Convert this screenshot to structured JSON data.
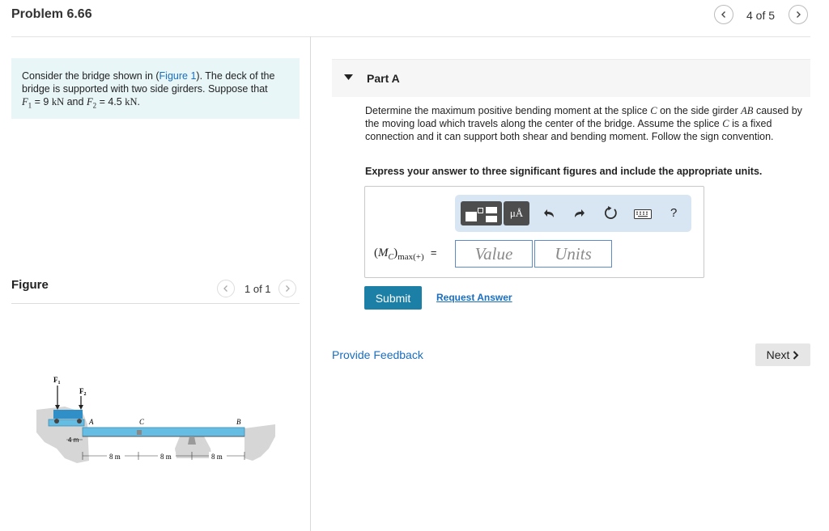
{
  "header": {
    "title": "Problem 6.66",
    "pager": "4 of 5"
  },
  "intro": {
    "text_before_link": "Consider the bridge shown in (",
    "figure_link": "Figure 1",
    "text_after_link": "). The deck of the bridge is supported with two side girders. Suppose that",
    "f1_symbol": "F",
    "f1_sub": "1",
    "f1_value": "= 9",
    "f1_unit": "kN",
    "and": "and",
    "f2_symbol": "F",
    "f2_sub": "2",
    "f2_value": "= 4.5",
    "f2_unit": "kN",
    "end": "."
  },
  "figure": {
    "heading": "Figure",
    "pager": "1 of 1",
    "labels": {
      "f1": "F",
      "f1_sub": "1",
      "f2": "F",
      "f2_sub": "2",
      "a": "A",
      "b": "B",
      "c": "C",
      "dim_4m": "4 m",
      "dim_8m_1": "8 m",
      "dim_8m_2": "8 m",
      "dim_8m_3": "8 m"
    }
  },
  "part": {
    "label": "Part A",
    "question": {
      "t1": "Determine the maximum positive bending moment at the splice",
      "c1": "C",
      "t2": "on the side girder",
      "ab": "AB",
      "t3": "caused by the moving load which travels along the center of the bridge. Assume the splice",
      "c2": "C",
      "t4": "is a fixed connection and it can support both shear and bending moment. Follow the sign convention."
    },
    "instruction": "Express your answer to three significant figures and include the appropriate units.",
    "answer": {
      "lhs_m": "M",
      "lhs_c": "C",
      "lhs_sub": "max(+)",
      "equals": "=",
      "value_placeholder": "Value",
      "units_placeholder": "Units"
    },
    "toolbar": {
      "units_symbol": "μÅ",
      "help": "?"
    },
    "submit": "Submit",
    "request_answer": "Request Answer"
  },
  "footer": {
    "provide_feedback": "Provide Feedback",
    "next": "Next"
  },
  "colors": {
    "intro_bg": "#e8f6f8",
    "link": "#1a6ec0",
    "submit_bg": "#1b7fa6",
    "toolbar_bg": "#d8e6f4"
  }
}
